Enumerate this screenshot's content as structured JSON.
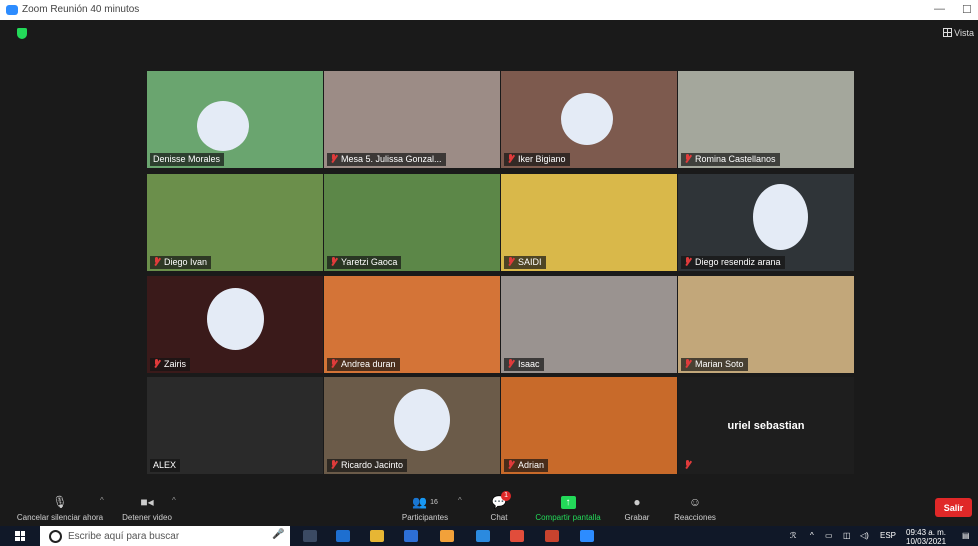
{
  "window": {
    "title": "Zoom Reunión 40 minutos",
    "controls": [
      "—",
      "☐",
      "✕"
    ]
  },
  "view_button": "Vista",
  "participants": [
    {
      "name": "Denisse Morales",
      "muted": false,
      "active": true,
      "bg": "#6aa56f",
      "has_face_blur": true
    },
    {
      "name": "Mesa 5. Julissa Gonzal...",
      "muted": true,
      "active": false,
      "bg": "#9c8c86",
      "has_face_blur": false
    },
    {
      "name": "Iker Bigiano",
      "muted": true,
      "active": false,
      "bg": "#7d5a4e",
      "has_face_blur": true
    },
    {
      "name": "Romina Castellanos",
      "muted": true,
      "active": false,
      "bg": "#a4a79c",
      "has_face_blur": false
    },
    {
      "name": "Diego Ivan",
      "muted": true,
      "active": false,
      "bg": "#6b8f4b",
      "has_face_blur": false
    },
    {
      "name": "Yaretzi Gaoca",
      "muted": true,
      "active": false,
      "bg": "#5c8748",
      "has_face_blur": false
    },
    {
      "name": "SAIDI",
      "muted": true,
      "active": false,
      "bg": "#d9b84a",
      "has_face_blur": false
    },
    {
      "name": "Diego resendiz arana",
      "muted": true,
      "active": false,
      "bg": "#2f3438",
      "has_face_blur": true
    },
    {
      "name": "Zairis",
      "muted": true,
      "active": false,
      "bg": "#3a1a1a",
      "has_face_blur": true
    },
    {
      "name": "Andrea duran",
      "muted": true,
      "active": false,
      "bg": "#d47437",
      "has_face_blur": false
    },
    {
      "name": "Isaac",
      "muted": true,
      "active": false,
      "bg": "#9a9390",
      "has_face_blur": false
    },
    {
      "name": "Marian Soto",
      "muted": true,
      "active": false,
      "bg": "#c2a77a",
      "has_face_blur": false
    },
    {
      "name": "ALEX",
      "muted": false,
      "active": false,
      "bg": "#2a2a2a",
      "has_face_blur": false
    },
    {
      "name": "Ricardo Jacinto",
      "muted": true,
      "active": false,
      "bg": "#6b5b49",
      "has_face_blur": true
    },
    {
      "name": "Adrian",
      "muted": true,
      "active": false,
      "bg": "#c86a2a",
      "has_face_blur": false
    },
    {
      "name": "",
      "muted": true,
      "active": false,
      "bg": "#1e1e1e",
      "has_face_blur": false,
      "center_name": "uriel sebastian"
    }
  ],
  "toolbar": {
    "unmute_label": "Cancelar silenciar ahora",
    "video_label": "Detener video",
    "participants_label": "Participantes",
    "participants_count": "16",
    "chat_label": "Chat",
    "chat_badge": "1",
    "share_label": "Compartir pantalla",
    "record_label": "Grabar",
    "reactions_label": "Reacciones",
    "leave_label": "Salir"
  },
  "taskbar": {
    "search_placeholder": "Escribe aquí para buscar",
    "lang": "ESP",
    "time": "09:43 a. m.",
    "date": "10/03/2021"
  },
  "colors": {
    "accent_green": "#23d959",
    "active_border": "#c4e04a",
    "leave_red": "#e02828",
    "muted_red": "#e03b3b"
  }
}
